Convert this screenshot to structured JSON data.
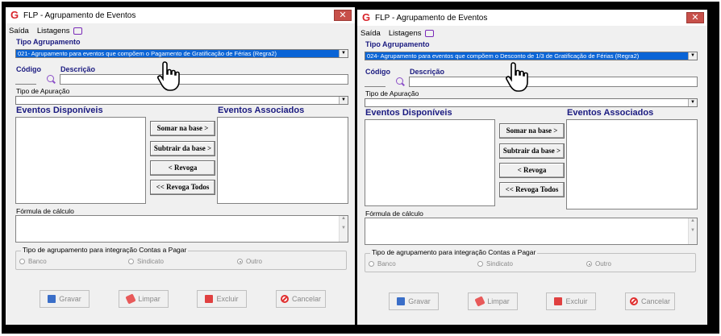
{
  "app": {
    "title": "FLP - Agrupamento de Eventos",
    "close_glyph": "✕"
  },
  "menu": {
    "saida": "Saída",
    "listagens": "Listagens"
  },
  "labels": {
    "tipo_agrupamento": "Tipo Agrupamento",
    "codigo": "Código",
    "descricao": "Descrição",
    "tipo_apuracao": "Tipo de Apuração",
    "eventos_disponiveis": "Eventos Disponíveis",
    "eventos_associados": "Eventos Associados",
    "formula": "Fórmula de cálculo",
    "grupo_integracao": "Tipo de agrupamento para integração Contas a Pagar"
  },
  "buttons": {
    "somar": "Somar  na base >",
    "subtrair": "Subtrair da base >",
    "revoga": "< Revoga",
    "revoga_todos": "<< Revoga Todos",
    "gravar": "Gravar",
    "limpar": "Limpar",
    "excluir": "Excluir",
    "cancelar": "Cancelar"
  },
  "radios": {
    "banco": "Banco",
    "sindicato": "Sindicato",
    "outro": "Outro"
  },
  "windows": [
    {
      "selected": "021- Agrupamento para eventos que compõem o Pagamento de Gratificação de Férias (Regra2)"
    },
    {
      "selected": "024- Agrupamento para eventos que compõem o Desconto de 1/3 de Gratificação de Férias (Regra2)"
    }
  ],
  "icons": {
    "app": "flp-logo-icon",
    "menu": "monitor-icon",
    "search": "search-icon",
    "cursor": "hand-cursor-icon"
  },
  "colors": {
    "accent": "#1a1a80",
    "selection": "#0a64d6",
    "close": "#c7504a"
  }
}
